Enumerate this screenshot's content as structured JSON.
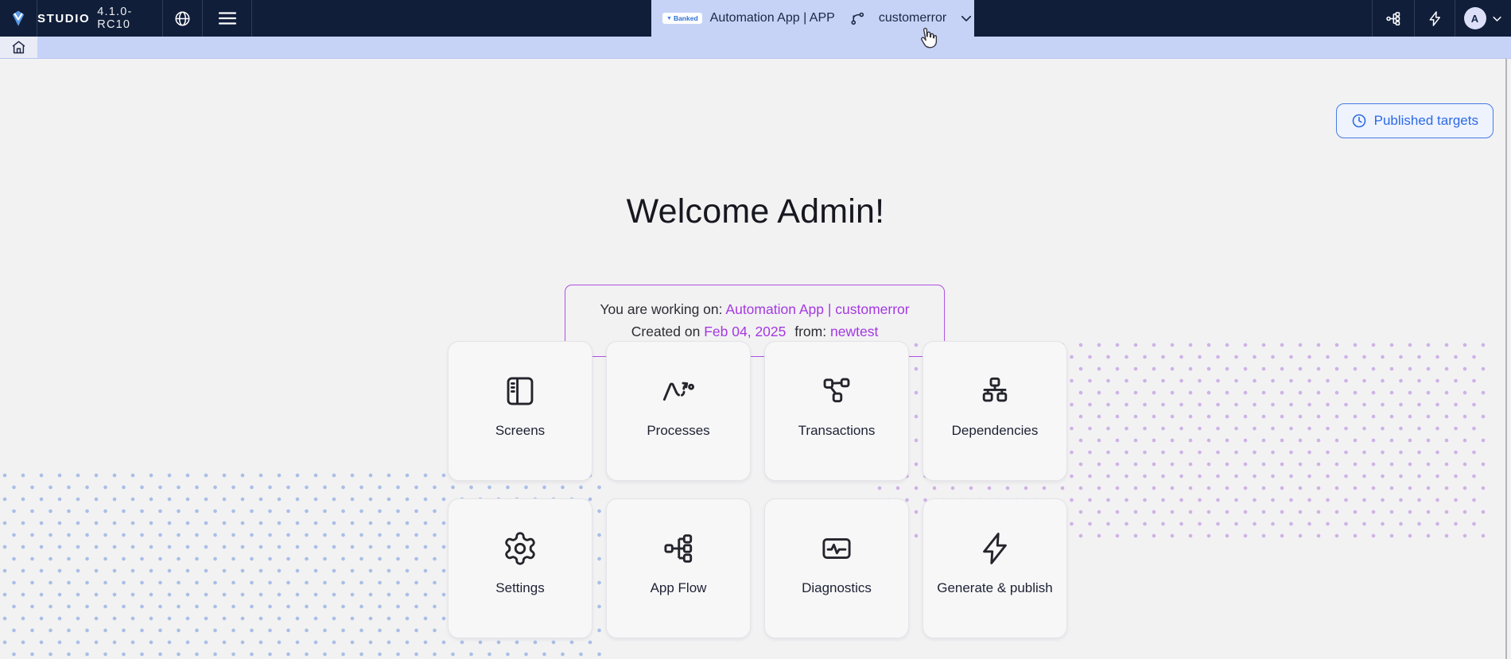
{
  "topbar": {
    "brand": "STUDIO",
    "version": "4.1.0-RC10",
    "app_tab": {
      "badge": "Banked",
      "title": "Automation App | APP",
      "branch": "customerror"
    },
    "avatar_initial": "A"
  },
  "page": {
    "published_button": "Published targets",
    "welcome_heading": "Welcome Admin!",
    "info": {
      "working_prefix": "You are working on:",
      "working_value": "Automation App | customerror",
      "created_prefix": "Created on",
      "created_date": "Feb 04, 2025",
      "from_prefix": "from:",
      "from_value": "newtest"
    },
    "cards": [
      {
        "label": "Screens",
        "icon": "screens-icon"
      },
      {
        "label": "Processes",
        "icon": "processes-icon"
      },
      {
        "label": "Transactions",
        "icon": "transactions-icon"
      },
      {
        "label": "Dependencies",
        "icon": "dependencies-icon"
      },
      {
        "label": "Settings",
        "icon": "settings-icon"
      },
      {
        "label": "App Flow",
        "icon": "app-flow-icon"
      },
      {
        "label": "Diagnostics",
        "icon": "diagnostics-icon"
      },
      {
        "label": "Generate & publish",
        "icon": "generate-publish-icon"
      }
    ]
  },
  "colors": {
    "topbar_bg": "#101e3a",
    "tab_bg": "#c6d3f7",
    "accent_blue": "#2d6ae3",
    "accent_purple": "#a438e0",
    "dot_blue": "#a9bfe7",
    "dot_purple": "#cfb2e7"
  }
}
